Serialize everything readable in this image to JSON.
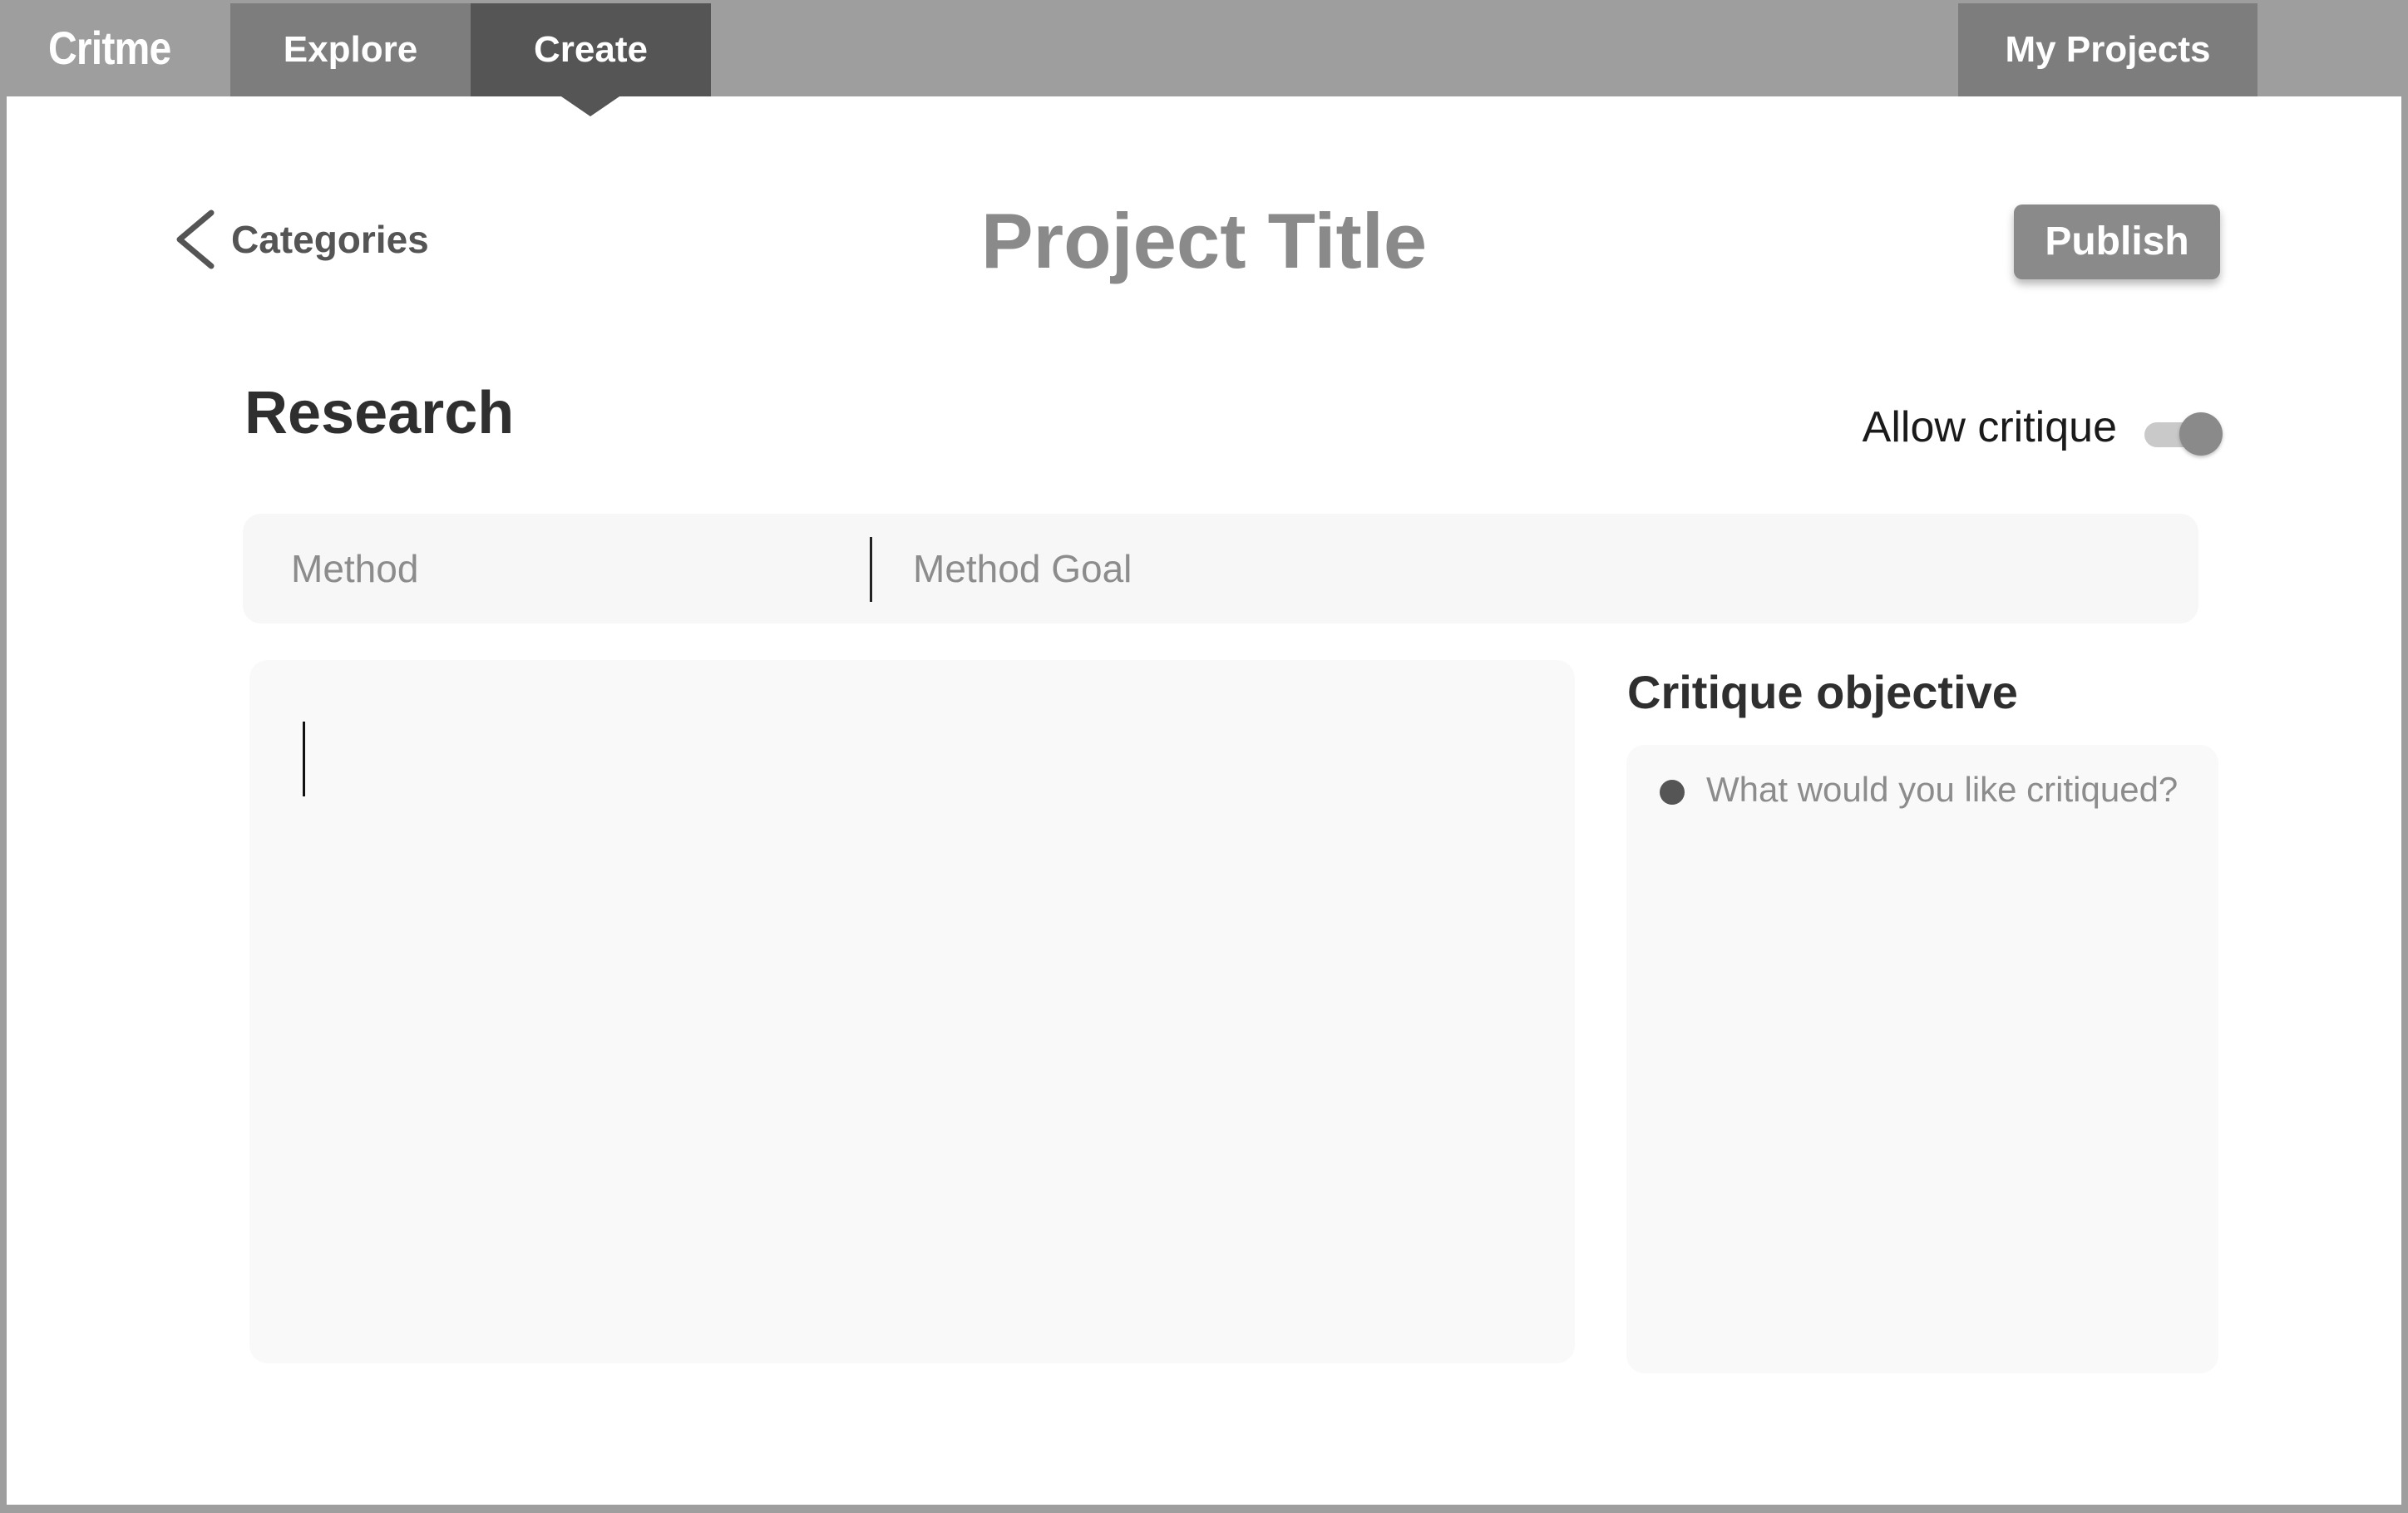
{
  "nav": {
    "logo": "Critme",
    "tabs": [
      "Explore",
      "Create"
    ],
    "active_tab": "Create",
    "my_projects": "My Projects"
  },
  "header": {
    "back_label": "Categories",
    "title": "Project Title",
    "publish_label": "Publish"
  },
  "section": {
    "title": "Research",
    "toggle_label": "Allow critique",
    "toggle_on": true
  },
  "method_bar": {
    "method_placeholder": "Method",
    "goal_placeholder": "Method Goal"
  },
  "editor": {
    "value": ""
  },
  "critique": {
    "heading": "Critique objective",
    "placeholder": "What would you like critiqued?"
  },
  "colors": {
    "nav_bg": "#9e9e9e",
    "tab_bg": "#7d7d7d",
    "active_tab_bg": "#555555",
    "publish_bg": "#8a8a8a",
    "panel_bg": "#f9f9f9"
  }
}
